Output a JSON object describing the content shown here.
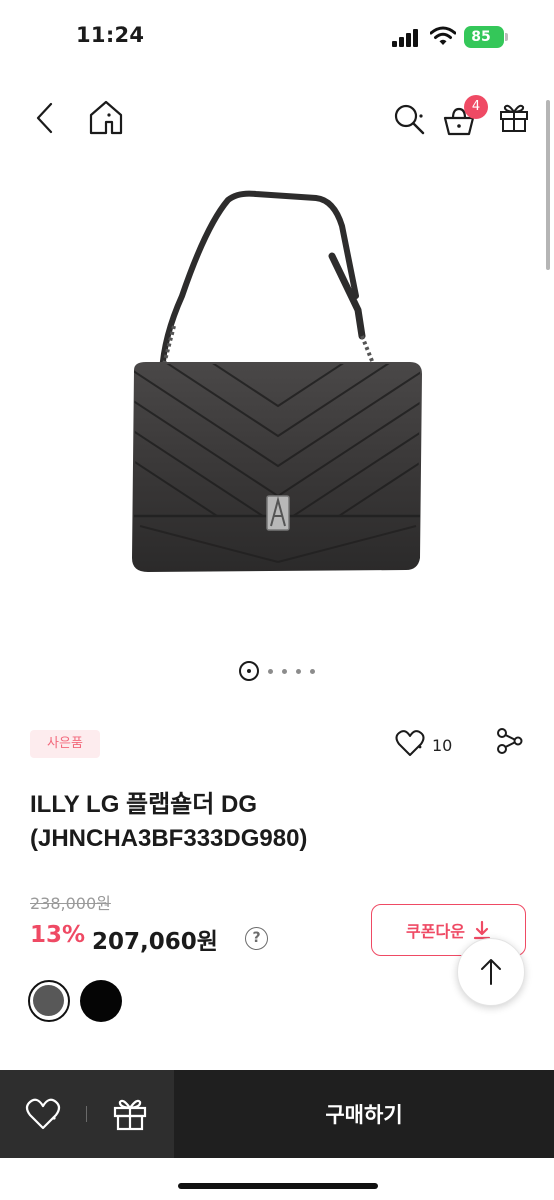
{
  "status_bar": {
    "time": "11:24",
    "battery": "85"
  },
  "header": {
    "cart_count": "4"
  },
  "product": {
    "gift_badge": "사은품",
    "like_count": "10",
    "title": "ILLY LG 플랩숄더 DG (JHNCHA3BF333DG980)",
    "original_price": "238,000원",
    "discount_rate": "13%",
    "sale_price": "207,060원",
    "help_symbol": "?",
    "coupon_label": "쿠폰다운",
    "color_options": [
      "dark-gray",
      "black"
    ]
  },
  "carousel": {
    "total": 5,
    "active": 1
  },
  "bottom_bar": {
    "buy_label": "구매하기"
  },
  "colors": {
    "accent": "#ef4a64",
    "bar_dark": "#1f1f1f",
    "battery": "#34c759"
  }
}
